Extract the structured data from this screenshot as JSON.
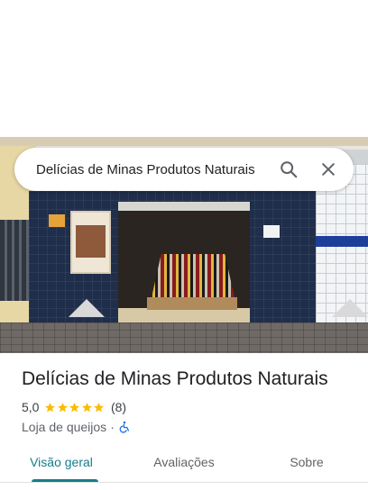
{
  "search": {
    "query": "Delícias de Minas Produtos Naturais"
  },
  "place": {
    "name": "Delícias de Minas Produtos Naturais",
    "rating": "5,0",
    "stars": 5,
    "review_count": "(8)",
    "category": "Loja de queijos",
    "separator": "·"
  },
  "tabs": [
    {
      "label": "Visão geral",
      "active": true
    },
    {
      "label": "Avaliações",
      "active": false
    },
    {
      "label": "Sobre",
      "active": false
    }
  ],
  "colors": {
    "star": "#fbbc04",
    "accent": "#137e8b",
    "accessibility": "#1a73e8"
  },
  "icons": {
    "search": "search-icon",
    "close": "close-icon",
    "accessibility": "wheelchair-icon"
  }
}
